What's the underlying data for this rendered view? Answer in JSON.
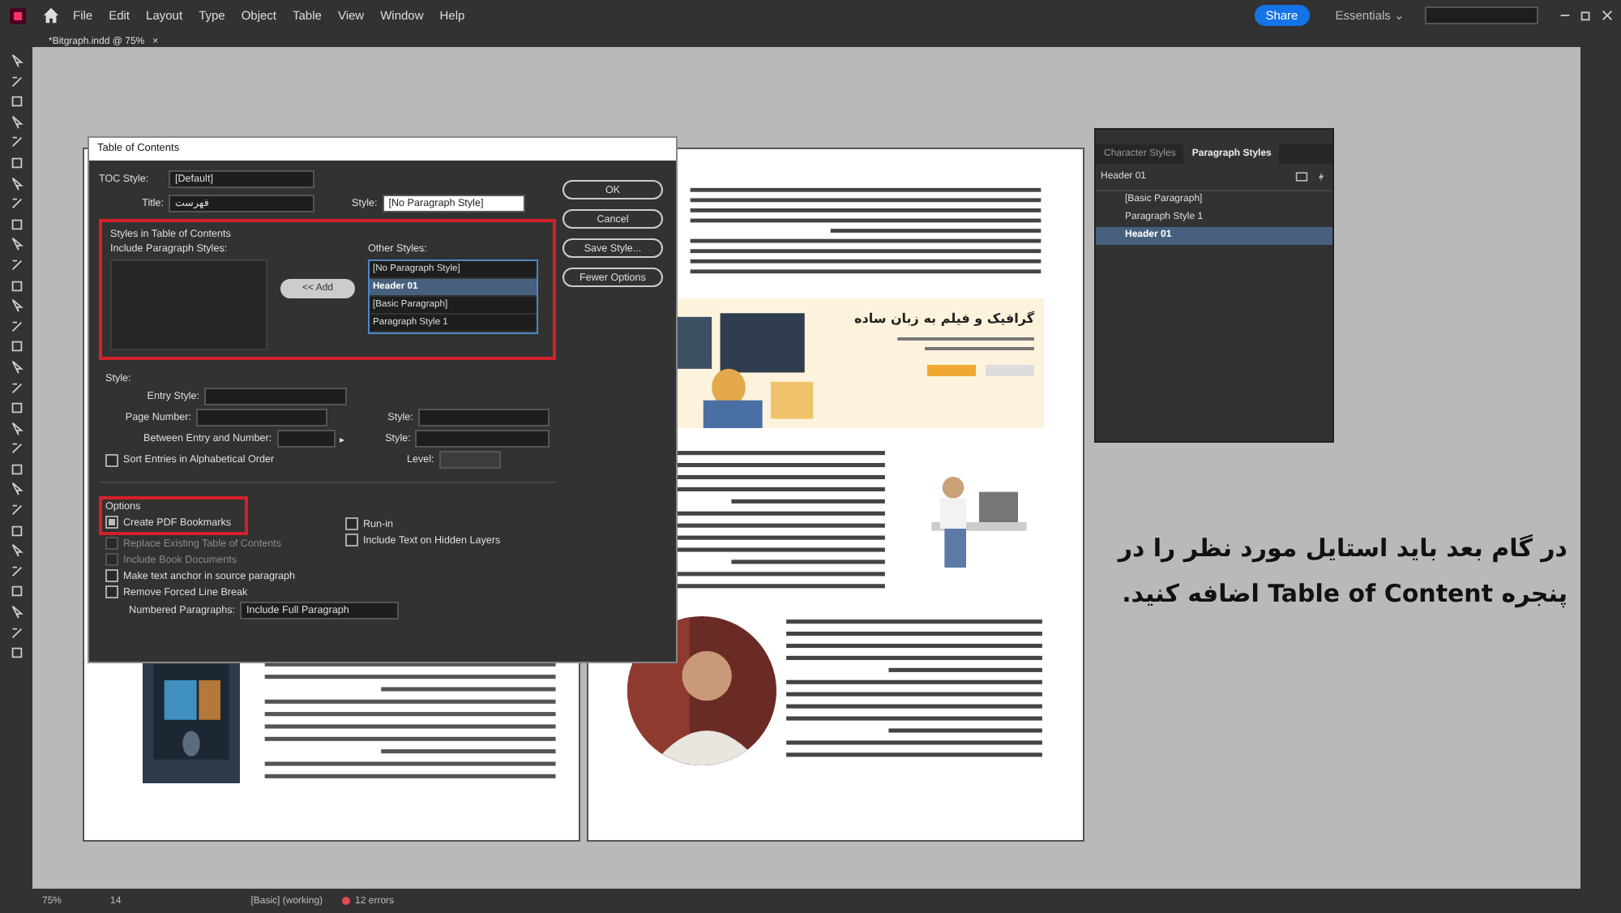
{
  "menu": [
    "File",
    "Edit",
    "Layout",
    "Type",
    "Object",
    "Table",
    "View",
    "Window",
    "Help"
  ],
  "share": "Share",
  "workspace": "Essentials",
  "workspace_caret": "⌄",
  "doc_tab": {
    "label": "*Bitgraph.indd @ 75%",
    "close": "×"
  },
  "dialog": {
    "title": "Table of Contents",
    "toc_style": {
      "label": "TOC Style:",
      "value": "[Default]"
    },
    "title_field": {
      "label": "Title:",
      "value": "فهرست"
    },
    "style_field": {
      "label": "Style:",
      "value": "[No Paragraph Style]"
    },
    "buttons": [
      "OK",
      "Cancel",
      "Save Style...",
      "Fewer Options"
    ],
    "styles_group": {
      "heading": "Styles in Table of Contents",
      "include_label": "Include Paragraph Styles:",
      "other_label": "Other Styles:",
      "add_button": "<< Add",
      "other_styles": [
        {
          "label": "[No Paragraph Style]",
          "selected": false
        },
        {
          "label": "Header 01",
          "selected": true
        },
        {
          "label": "[Basic Paragraph]",
          "selected": false
        },
        {
          "label": "Paragraph Style 1",
          "selected": false
        }
      ]
    },
    "style_section": {
      "heading": "Style:",
      "entry_style": "Entry Style:",
      "page_number": "Page Number:",
      "between": "Between Entry and Number:",
      "between_arrow": "▸",
      "style_a": "Style:",
      "style_b": "Style:",
      "level": "Level:",
      "sort": {
        "label": "Sort Entries in Alphabetical Order",
        "checked": false
      }
    },
    "options": {
      "heading": "Options",
      "left": [
        {
          "label": "Create PDF Bookmarks",
          "checked": true,
          "disabled": false
        },
        {
          "label": "Replace Existing Table of Contents",
          "checked": false,
          "disabled": true
        },
        {
          "label": "Include Book Documents",
          "checked": false,
          "disabled": true
        },
        {
          "label": "Make text anchor in source paragraph",
          "checked": false,
          "disabled": false
        },
        {
          "label": "Remove Forced Line Break",
          "checked": false,
          "disabled": false
        }
      ],
      "right": [
        {
          "label": "Run-in",
          "checked": false,
          "disabled": false
        },
        {
          "label": "Include Text on Hidden Layers",
          "checked": false,
          "disabled": false
        }
      ],
      "numbered": {
        "label": "Numbered Paragraphs:",
        "value": "Include Full Paragraph"
      }
    }
  },
  "panel": {
    "tabs": [
      {
        "label": "Character Styles",
        "selected": false
      },
      {
        "label": "Paragraph Styles",
        "selected": true
      }
    ],
    "current": "Header 01",
    "items": [
      {
        "label": "[Basic Paragraph]",
        "selected": false
      },
      {
        "label": "Paragraph Style 1",
        "selected": false
      },
      {
        "label": "Header 01",
        "selected": true
      }
    ]
  },
  "document": {
    "banner_heading": "گرافیک و فیلم به زبان ساده"
  },
  "caption": "در گام بعد باید استایل مورد نظر را در پنجره Table of Content اضافه کنید.",
  "status": {
    "zoom": "75%",
    "page": "14",
    "style": "[Basic] (working)",
    "errors": "12 errors"
  }
}
